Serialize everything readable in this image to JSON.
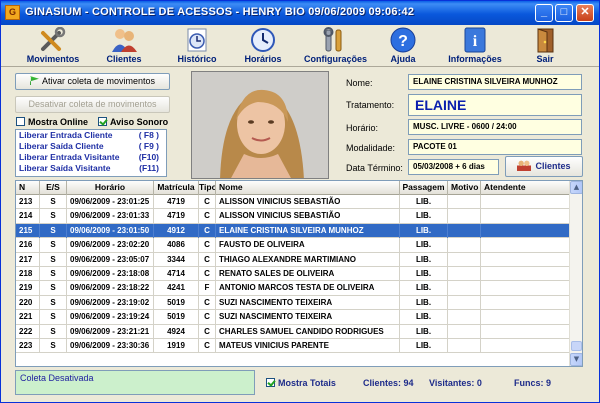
{
  "window": {
    "title": "GINASIUM - CONTROLE DE ACESSOS - HENRY BIO 09/06/2009 09:06:42",
    "icon_letter": "G"
  },
  "title_buttons": {
    "minimize": "_",
    "maximize": "□",
    "close": "✕"
  },
  "toolbar": [
    {
      "label": "Movimentos",
      "icon": "tools-icon"
    },
    {
      "label": "Clientes",
      "icon": "people-icon"
    },
    {
      "label": "Histórico",
      "icon": "history-icon"
    },
    {
      "label": "Horários",
      "icon": "clock-icon"
    },
    {
      "label": "Configurações",
      "icon": "wrench-icon"
    },
    {
      "label": "Ajuda",
      "icon": "help-icon"
    },
    {
      "label": "Informações",
      "icon": "info-icon"
    },
    {
      "label": "Sair",
      "icon": "exit-door-icon"
    }
  ],
  "controls": {
    "activate_button": "Ativar coleta de movimentos",
    "deactivate_button": "Desativar coleta de movimentos",
    "mostra_online": {
      "label": "Mostra Online",
      "checked": false
    },
    "aviso_sonoro": {
      "label": "Aviso Sonoro",
      "checked": true
    }
  },
  "shortcuts": [
    {
      "label": "Liberar Entrada Cliente",
      "key": "( F8 )"
    },
    {
      "label": "Liberar Saída Cliente",
      "key": "( F9 )"
    },
    {
      "label": "Liberar Entrada Visitante",
      "key": "(F10)"
    },
    {
      "label": "Liberar Saída Visitante",
      "key": "(F11)"
    }
  ],
  "client": {
    "nome_label": "Nome:",
    "nome": "ELAINE CRISTINA SILVEIRA MUNHOZ",
    "tratamento_label": "Tratamento:",
    "tratamento": "ELAINE",
    "horario_label": "Horário:",
    "horario": "MUSC. LIVRE - 0600 / 24:00",
    "modalidade_label": "Modalidade:",
    "modalidade": "PACOTE 01",
    "data_termino_label": "Data Término:",
    "data_termino": "05/03/2008 + 6 dias",
    "clientes_button": "Clientes"
  },
  "table": {
    "columns": [
      "N",
      "E/S",
      "Horário",
      "Matrícula",
      "Tipo",
      "Nome",
      "Passagem",
      "Motivo",
      "Atendente"
    ],
    "selected_index": 2,
    "rows": [
      [
        "213",
        "S",
        "09/06/2009 - 23:01:25",
        "4719",
        "C",
        "ALISSON VINICIUS SEBASTIÃO",
        "LIB.",
        "",
        ""
      ],
      [
        "214",
        "S",
        "09/06/2009 - 23:01:33",
        "4719",
        "C",
        "ALISSON VINICIUS SEBASTIÃO",
        "LIB.",
        "",
        ""
      ],
      [
        "215",
        "S",
        "09/06/2009 - 23:01:50",
        "4912",
        "C",
        "ELAINE CRISTINA SILVEIRA MUNHOZ",
        "LIB.",
        "",
        ""
      ],
      [
        "216",
        "S",
        "09/06/2009 - 23:02:20",
        "4086",
        "C",
        "FAUSTO DE OLIVEIRA",
        "LIB.",
        "",
        ""
      ],
      [
        "217",
        "S",
        "09/06/2009 - 23:05:07",
        "3344",
        "C",
        "THIAGO ALEXANDRE MARTIMIANO",
        "LIB.",
        "",
        ""
      ],
      [
        "218",
        "S",
        "09/06/2009 - 23:18:08",
        "4714",
        "C",
        "RENATO SALES DE OLIVEIRA",
        "LIB.",
        "",
        ""
      ],
      [
        "219",
        "S",
        "09/06/2009 - 23:18:22",
        "4241",
        "F",
        "ANTONIO MARCOS TESTA DE OLIVEIRA",
        "LIB.",
        "",
        ""
      ],
      [
        "220",
        "S",
        "09/06/2009 - 23:19:02",
        "5019",
        "C",
        "SUZI NASCIMENTO TEIXEIRA",
        "LIB.",
        "",
        ""
      ],
      [
        "221",
        "S",
        "09/06/2009 - 23:19:24",
        "5019",
        "C",
        "SUZI NASCIMENTO TEIXEIRA",
        "LIB.",
        "",
        ""
      ],
      [
        "222",
        "S",
        "09/06/2009 - 23:21:21",
        "4924",
        "C",
        "CHARLES SAMUEL CANDIDO RODRIGUES",
        "LIB.",
        "",
        ""
      ],
      [
        "223",
        "S",
        "09/06/2009 - 23:30:36",
        "1919",
        "C",
        "MATEUS VINICIUS PARENTE",
        "LIB.",
        "",
        ""
      ]
    ]
  },
  "status": {
    "coleta": "Coleta Desativada",
    "mostra_totais": {
      "label": "Mostra Totais",
      "checked": true
    },
    "clientes": "Clientes: 94",
    "visitantes": "Visitantes: 0",
    "funcs": "Funcs: 9"
  },
  "colors": {
    "selection": "#316ac5",
    "field_bg": "#ffffe1",
    "status_bg": "#ccf0cc",
    "label_blue": "#1f2fa5"
  }
}
